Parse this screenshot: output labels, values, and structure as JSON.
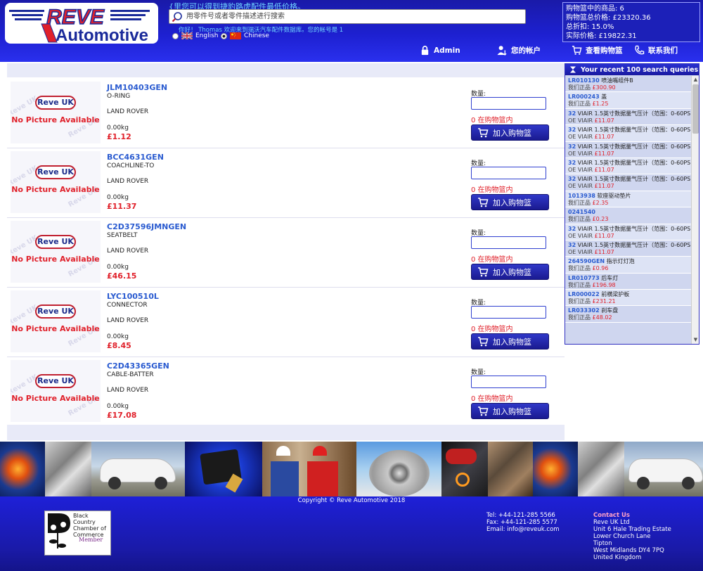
{
  "header": {
    "logo_top": "REVE",
    "logo_bottom": "Automotive",
    "tagline": "{里您可以得到捷豹路虎配件最低价格。",
    "search_placeholder": "用零件号或者零件描述进行搜索",
    "welcome": "你好！ Thomas 欢迎来到瑞沃汽车配件数据库。您的帐号是 1",
    "languages": [
      {
        "label": "English",
        "selected": false
      },
      {
        "label": "Chinese",
        "selected": true
      }
    ]
  },
  "basket": {
    "items": "购物篮中的商品: 6",
    "total": "购物篮总价格: £23320.36",
    "discount": "总折扣: 15.0%",
    "actual": "实际价格: £19822.31"
  },
  "nav": {
    "admin": "Admin",
    "account": "您的帐户",
    "view_basket": "查看购物篮",
    "contact": "联系我们"
  },
  "product_labels": {
    "qty": "数量:",
    "in_cart": "0 在购物篮内",
    "add_to_cart": "加入购物篮",
    "no_picture": "No Picture Available",
    "reve_uk": "Reve UK"
  },
  "products": [
    {
      "code": "JLM10403GEN",
      "desc": "O-RING",
      "make": "LAND ROVER",
      "weight": "0.00kg",
      "price": "£1.12"
    },
    {
      "code": "BCC4631GEN",
      "desc": "COACHLINE-TO",
      "make": "LAND ROVER",
      "weight": "0.00kg",
      "price": "£11.37"
    },
    {
      "code": "C2D37596JMNGEN",
      "desc": "SEATBELT",
      "make": "LAND ROVER",
      "weight": "0.00kg",
      "price": "£46.15"
    },
    {
      "code": "LYC100510L",
      "desc": "CONNECTOR",
      "make": "LAND ROVER",
      "weight": "0.00kg",
      "price": "£8.45"
    },
    {
      "code": "C2D43365GEN",
      "desc": "CABLE-BATTER",
      "make": "LAND ROVER",
      "weight": "0.00kg",
      "price": "£17.08"
    }
  ],
  "recent": {
    "title": "Your recent 100 search queries",
    "items": [
      {
        "code": "LR010130",
        "text": " 喷油嘴组件B",
        "price_label": "我们正品 ",
        "price": "£300.90"
      },
      {
        "code": "LR000243",
        "text": " 盖",
        "price_label": "我们正品 ",
        "price": "£1.25"
      },
      {
        "code": "32",
        "text": " VIAIR 1.5英寸数据量气压计（范围：0-60PSI）",
        "price_label": "OE VIAIR ",
        "price": "£11.07"
      },
      {
        "code": "32",
        "text": " VIAIR 1.5英寸数据量气压计（范围：0-60PSI）",
        "price_label": "OE VIAIR ",
        "price": "£11.07"
      },
      {
        "code": "32",
        "text": " VIAIR 1.5英寸数据量气压计（范围：0-60PSI）",
        "price_label": "OE VIAIR ",
        "price": "£11.07"
      },
      {
        "code": "32",
        "text": " VIAIR 1.5英寸数据量气压计（范围：0-60PSI）",
        "price_label": "OE VIAIR ",
        "price": "£11.07"
      },
      {
        "code": "32",
        "text": " VIAIR 1.5英寸数据量气压计（范围：0-60PSI）",
        "price_label": "OE VIAIR ",
        "price": "£11.07"
      },
      {
        "code": "1013938",
        "text": " 软座驱动垫片",
        "price_label": "我们正品 ",
        "price": "£2.35"
      },
      {
        "code": "0241540",
        "text": "",
        "price_label": "我们正品 ",
        "price": "£0.23"
      },
      {
        "code": "32",
        "text": " VIAIR 1.5英寸数据量气压计（范围：0-60PSI）",
        "price_label": "OE VIAIR ",
        "price": "£11.07"
      },
      {
        "code": "32",
        "text": " VIAIR 1.5英寸数据量气压计（范围：0-60PSI）",
        "price_label": "OE VIAIR ",
        "price": "£11.07"
      },
      {
        "code": "264590GEN",
        "text": " 指示灯灯泡",
        "price_label": "我们正品 ",
        "price": "£0.96"
      },
      {
        "code": "LR010773",
        "text": " 后车灯",
        "price_label": "我们正品 ",
        "price": "£196.98"
      },
      {
        "code": "LR000022",
        "text": " 前横梁护板",
        "price_label": "我们正品 ",
        "price": "£231.21"
      },
      {
        "code": "LR033302",
        "text": " 刹车盘",
        "price_label": "我们正品 ",
        "price": "£48.02"
      }
    ]
  },
  "footer": {
    "copyright": "Copyright © Reve Automotive 2018",
    "bccc_lines": [
      "Black Country",
      "Chamber of",
      "Commerce"
    ],
    "bccc_member": "Member",
    "tel": "Tel: +44-121-285 5566",
    "fax": "Fax: +44-121-285 5577",
    "email": "Email: info@reveuk.com",
    "contact_title": "Contact Us",
    "address": [
      "Reve UK Ltd",
      "Unit 6 Hale Trading Estate",
      "Lower Church Lane",
      "Tipton",
      "West Midlands DY4 7PQ",
      "United Kingdom"
    ]
  },
  "colors": {
    "header_blue": "#1d20d0",
    "link_blue": "#2a5bd0",
    "price_red": "#e0202a"
  },
  "icons": [
    "search-icon",
    "lock-icon",
    "user-icon",
    "cart-icon",
    "phone-icon",
    "hourglass-icon",
    "flag-uk-icon",
    "flag-china-icon"
  ]
}
